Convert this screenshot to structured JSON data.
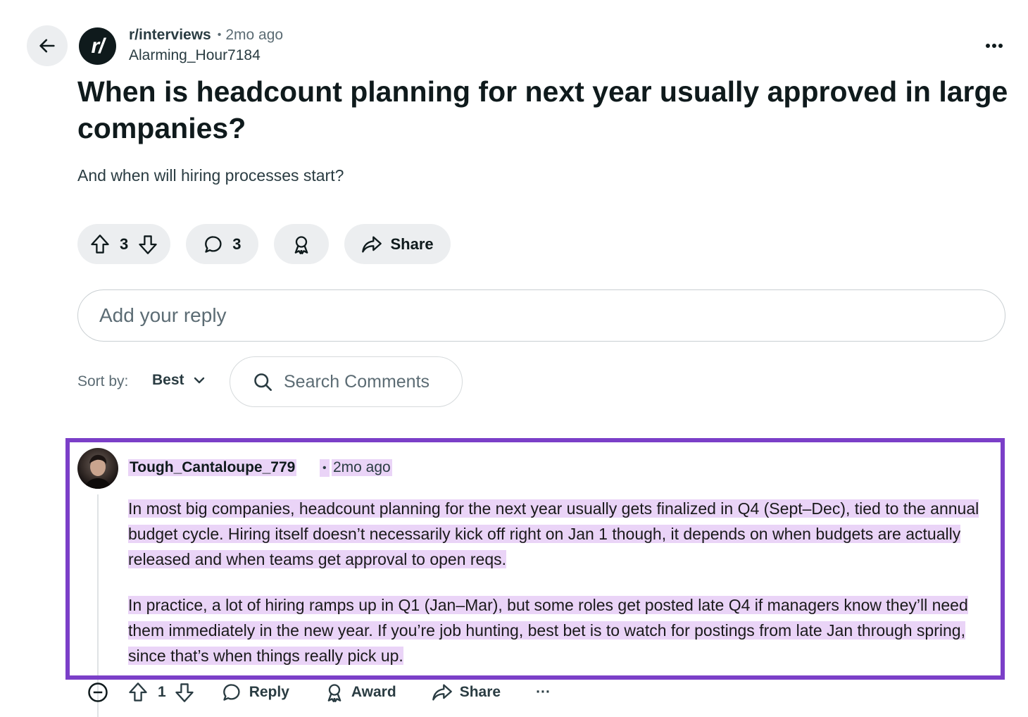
{
  "post": {
    "subreddit": "r/interviews",
    "separator": "•",
    "time": "2mo ago",
    "author": "Alarming_Hour7184",
    "subreddit_avatar_text": "r/",
    "title": "When is headcount planning for next year usually approved in large companies?",
    "body": "And when will hiring processes start?",
    "upvotes": "3",
    "comments": "3",
    "share_label": "Share"
  },
  "reply": {
    "placeholder": "Add your reply"
  },
  "sort": {
    "label": "Sort by:",
    "value": "Best"
  },
  "search": {
    "placeholder": "Search Comments"
  },
  "comment": {
    "author": "Tough_Cantaloupe_779",
    "separator": "•",
    "time": "2mo ago",
    "paragraphs": [
      "In most big companies, headcount planning for the next year usually gets finalized in Q4 (Sept–Dec), tied to the annual budget cycle. Hiring itself doesn’t necessarily kick off right on Jan 1 though, it depends on when budgets are actually released and when teams get approval to open reqs.",
      "In practice, a lot of hiring ramps up in Q1 (Jan–Mar), but some roles get posted late Q4 if managers know they’ll need them immediately in the new year. If you’re job hunting, best bet is to watch for postings from late Jan through spring, since that’s when things really pick up."
    ],
    "upvotes": "1",
    "reply_label": "Reply",
    "award_label": "Award",
    "share_label": "Share",
    "more_label": "···"
  },
  "colors": {
    "highlight_border": "#7b3fc8",
    "highlight_fill": "#ead4f7",
    "pill_bg": "#eceef0"
  }
}
